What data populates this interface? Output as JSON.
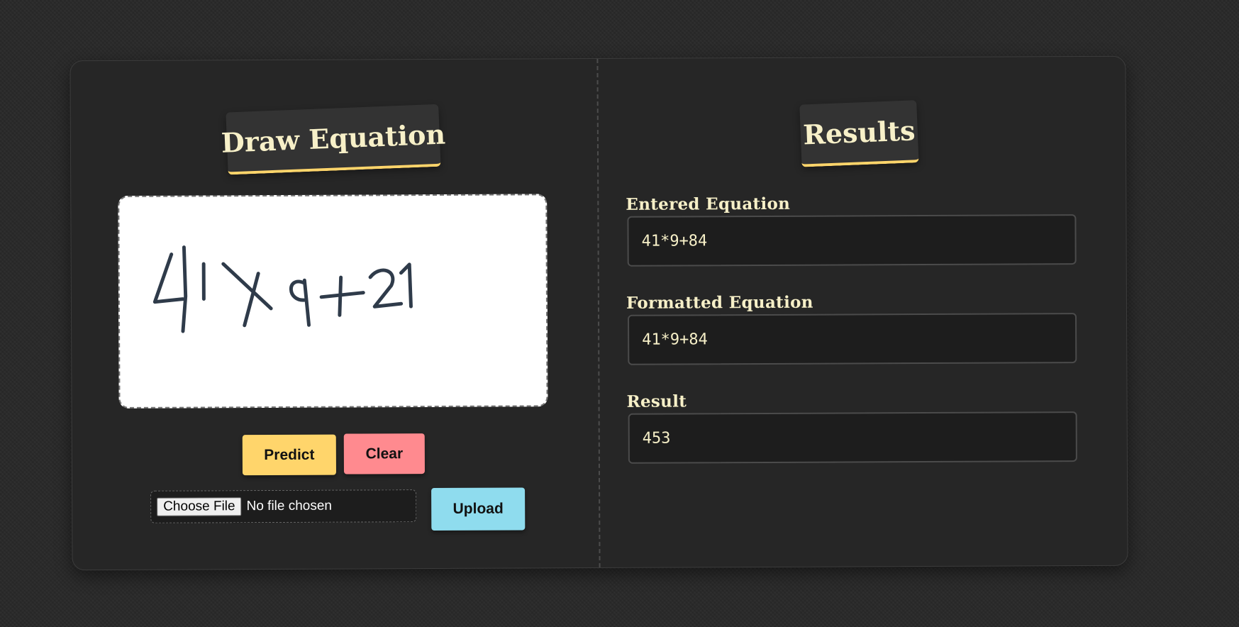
{
  "left_panel": {
    "title": "Draw Equation",
    "buttons": {
      "predict": "Predict",
      "clear": "Clear",
      "upload": "Upload"
    },
    "file_input": {
      "button_label": "Choose File",
      "status": "No file chosen"
    }
  },
  "right_panel": {
    "title": "Results",
    "fields": [
      {
        "label": "Entered Equation",
        "value": "41*9+84"
      },
      {
        "label": "Formatted Equation",
        "value": "41*9+84"
      },
      {
        "label": "Result",
        "value": "453"
      }
    ]
  },
  "colors": {
    "accent_yellow": "#ffd56b",
    "clear_red": "#ff8a8f",
    "upload_cyan": "#8fdcee",
    "ink": "#2f3b4a"
  }
}
